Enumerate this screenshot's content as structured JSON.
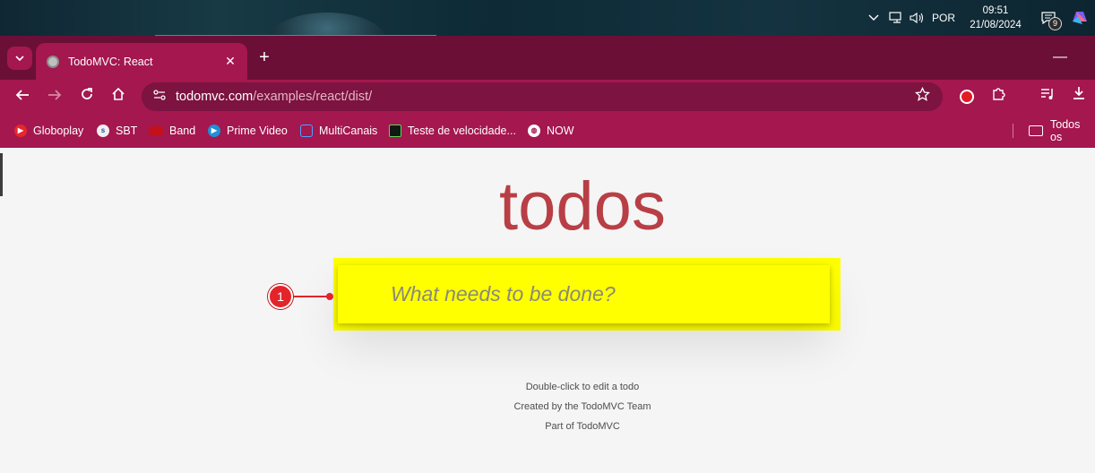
{
  "taskbar": {
    "language": "POR",
    "time": "09:51",
    "date": "21/08/2024",
    "notification_count": "9",
    "icons": [
      "chevron-up-icon",
      "network-icon",
      "volume-icon",
      "notification-icon",
      "copilot-icon"
    ]
  },
  "browser": {
    "tab_title": "TodoMVC: React",
    "new_tab_label": "+",
    "minimize_label": "—",
    "url_host": "todomvc.com",
    "url_path": "/examples/react/dist/",
    "bookmarks": [
      "Globoplay",
      "SBT",
      "Band",
      "Prime Video",
      "MultiCanais",
      "Teste de velocidade...",
      "NOW"
    ],
    "bookmarks_folder": "Todos os"
  },
  "page": {
    "heading": "todos",
    "input_placeholder": "What needs to be done?",
    "info_lines": [
      "Double-click to edit a todo",
      "Created by the TodoMVC Team",
      "Part of TodoMVC"
    ]
  },
  "annotation": {
    "marker_label": "1",
    "highlight_color": "#ffff00",
    "marker_color": "#e3242b"
  },
  "colors": {
    "chrome_dark": "#6b0f36",
    "chrome": "#a4174f",
    "todo_title": "#b83f45"
  }
}
